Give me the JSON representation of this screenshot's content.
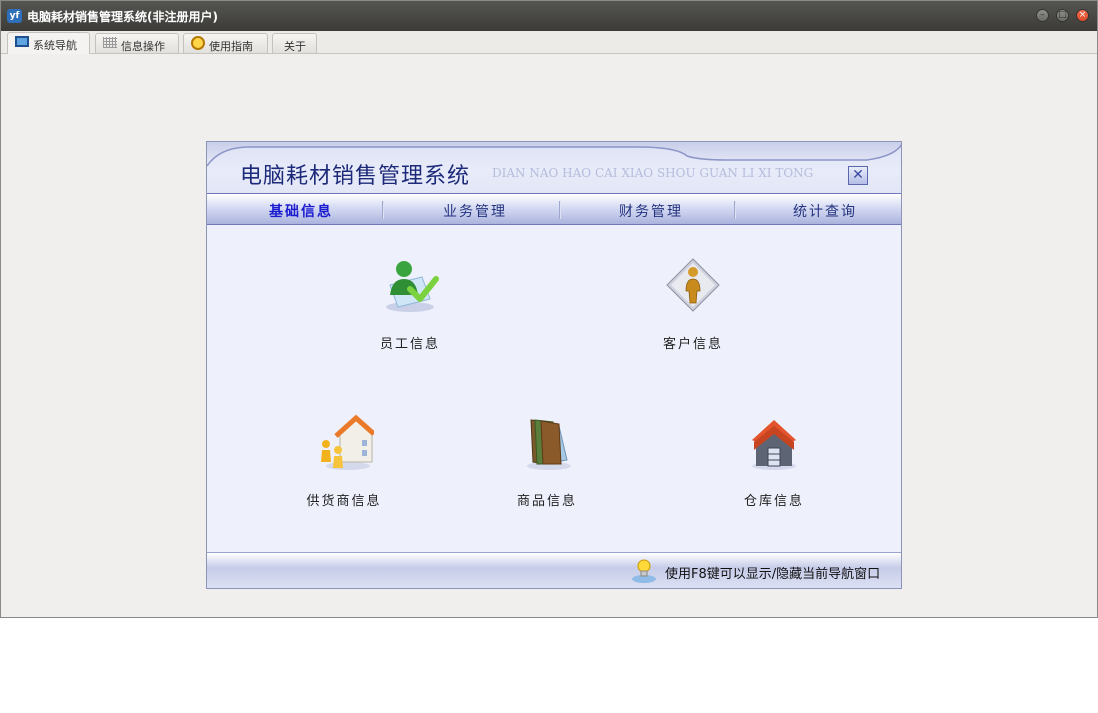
{
  "window": {
    "title": "电脑耗材销售管理系统(非注册用户)",
    "app_icon": "yf-logo-icon",
    "controls": [
      "minimize-icon",
      "maximize-icon",
      "close-icon"
    ]
  },
  "tabs": [
    {
      "label": "系统导航",
      "icon": "monitor-icon",
      "active": true
    },
    {
      "label": "信息操作",
      "icon": "grid-icon",
      "active": false
    },
    {
      "label": "使用指南",
      "icon": "help-globe-icon",
      "active": false
    },
    {
      "label": "关于",
      "icon": "",
      "active": false
    }
  ],
  "panel": {
    "title": "电脑耗材销售管理系统",
    "pinyin": "DIAN NAO HAO CAI XIAO SHOU GUAN LI XI TONG",
    "close_symbol": "✕",
    "menu": [
      {
        "label": "基础信息",
        "active": true
      },
      {
        "label": "业务管理",
        "active": false
      },
      {
        "label": "财务管理",
        "active": false
      },
      {
        "label": "统计查询",
        "active": false
      }
    ],
    "functions": [
      {
        "label": "员工信息",
        "icon": "employee-icon"
      },
      {
        "label": "客户信息",
        "icon": "customer-icon"
      },
      {
        "label": "供货商信息",
        "icon": "supplier-icon"
      },
      {
        "label": "商品信息",
        "icon": "product-books-icon"
      },
      {
        "label": "仓库信息",
        "icon": "warehouse-icon"
      }
    ],
    "footer_hint": "使用F8键可以显示/隐藏当前导航窗口",
    "footer_icon": "lightbulb-icon"
  },
  "colors": {
    "titlebar": "#3c3b37",
    "panel_bg": "#eef0fb",
    "menu_active": "#1a1ad0",
    "panel_title": "#1d2a7a"
  }
}
